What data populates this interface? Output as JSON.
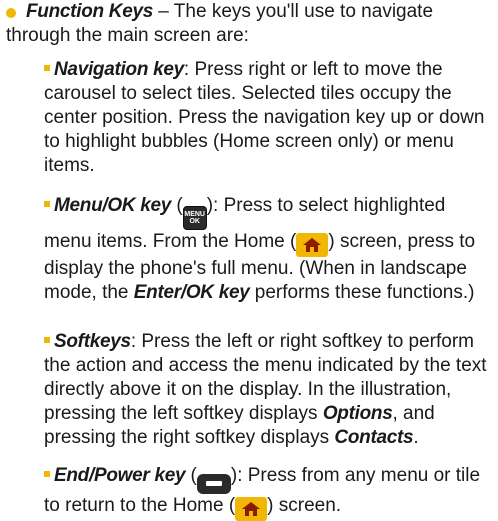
{
  "intro": {
    "term": "Function Keys",
    "text_a": " – The keys you'll use to navigate",
    "text_b": "through the main screen are:"
  },
  "items": [
    {
      "term": "Navigation key",
      "text": ": Press right or left to move the carousel to select tiles. Selected tiles occupy the center position. Press the navigation key up or down to highlight bubbles (Home screen only) or menu items."
    },
    {
      "term": "Menu/OK key",
      "text_a": " (",
      "icon": "menu-ok-key-icon",
      "icon_label_1": "MENU",
      "icon_label_2": "OK",
      "text_b": "): Press to select highlighted menu items. From the Home (",
      "home_icon": "home-icon",
      "text_c": ") screen, press to display the phone's full menu. (When in landscape mode, the ",
      "term2": "Enter/OK key",
      "text_d": " performs these functions.)"
    },
    {
      "term": "Softkeys",
      "text_a": ": Press the left or right softkey to perform the action and access the menu indicated by the text directly above it on the display. In the illustration, pressing the left softkey displays ",
      "term2": "Options",
      "text_b": ", and pressing the right softkey displays ",
      "term3": "Contacts",
      "text_c": "."
    },
    {
      "term": "End/Power key",
      "text_a": " (",
      "icon": "end-power-key-icon",
      "text_b": "): Press from any menu or tile to return to the Home (",
      "home_icon": "home-icon",
      "text_c": ") screen."
    }
  ],
  "colors": {
    "bullet": "#f2b705",
    "icon_dark": "#2a2a2a",
    "home_bg": "#f2b705",
    "home_glyph": "#8a1c00"
  }
}
